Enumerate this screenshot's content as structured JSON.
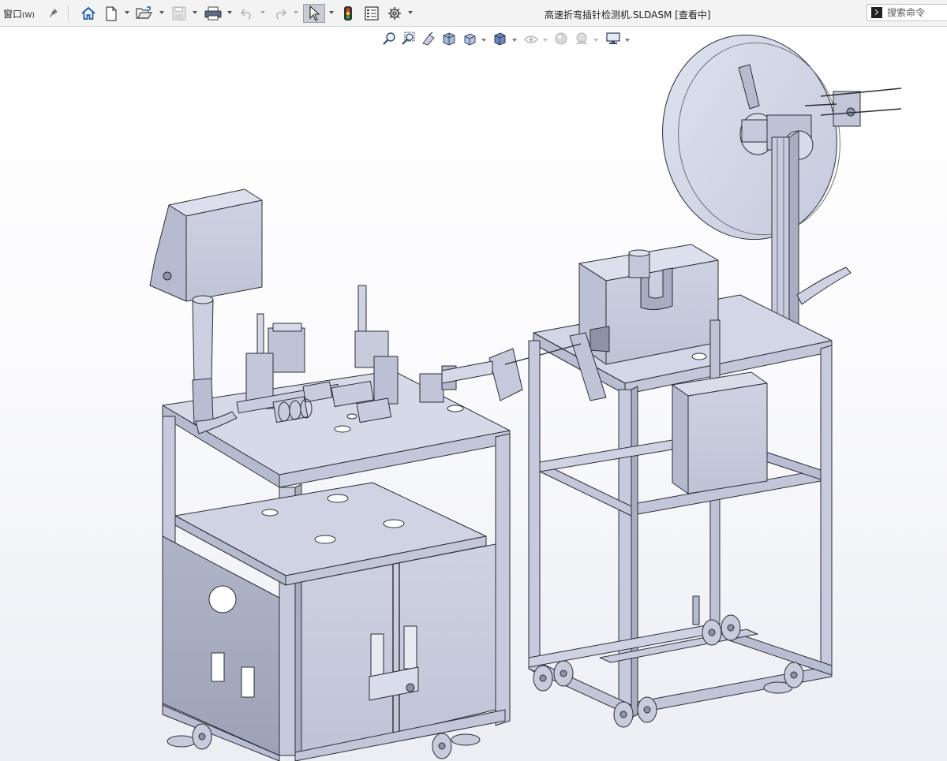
{
  "menu": {
    "window_label": "窗口",
    "window_accel": "(W)"
  },
  "document": {
    "title": "高速折弯插针检测机.SLDASM [查看中]"
  },
  "search": {
    "placeholder": "搜索命令"
  },
  "colors": {
    "toolbar_bg": "#f3f3f3",
    "model_fill": "#d3d6e6",
    "model_stroke": "#2b2d36",
    "viewport_bottom": "#eceef4"
  },
  "toolbar": {
    "buttons": [
      {
        "name": "home-button",
        "icon": "home-icon"
      },
      {
        "name": "new-document-button",
        "icon": "new-document-icon"
      },
      {
        "name": "open-button",
        "icon": "open-folder-icon"
      },
      {
        "name": "save-button",
        "icon": "save-icon"
      },
      {
        "name": "print-button",
        "icon": "print-icon"
      },
      {
        "name": "undo-button",
        "icon": "undo-icon"
      },
      {
        "name": "redo-button",
        "icon": "redo-icon"
      },
      {
        "name": "select-button",
        "icon": "cursor-arrow-icon"
      },
      {
        "name": "rebuild-button",
        "icon": "traffic-light-icon"
      },
      {
        "name": "file-properties-button",
        "icon": "file-properties-icon"
      },
      {
        "name": "options-button",
        "icon": "gear-icon"
      }
    ]
  },
  "heads_up_toolbar": {
    "buttons": [
      {
        "name": "zoom-to-fit-button",
        "icon": "zoom-fit-icon"
      },
      {
        "name": "zoom-to-area-button",
        "icon": "zoom-area-icon"
      },
      {
        "name": "previous-view-button",
        "icon": "previous-view-icon"
      },
      {
        "name": "section-view-button",
        "icon": "section-view-icon"
      },
      {
        "name": "view-orientation-button",
        "icon": "view-orientation-icon"
      },
      {
        "name": "display-style-button",
        "icon": "display-style-icon"
      },
      {
        "name": "hide-show-items-button",
        "icon": "eye-icon"
      },
      {
        "name": "edit-appearance-button",
        "icon": "appearance-sphere-icon"
      },
      {
        "name": "apply-scene-button",
        "icon": "scene-icon"
      },
      {
        "name": "view-settings-button",
        "icon": "monitor-icon"
      }
    ]
  }
}
